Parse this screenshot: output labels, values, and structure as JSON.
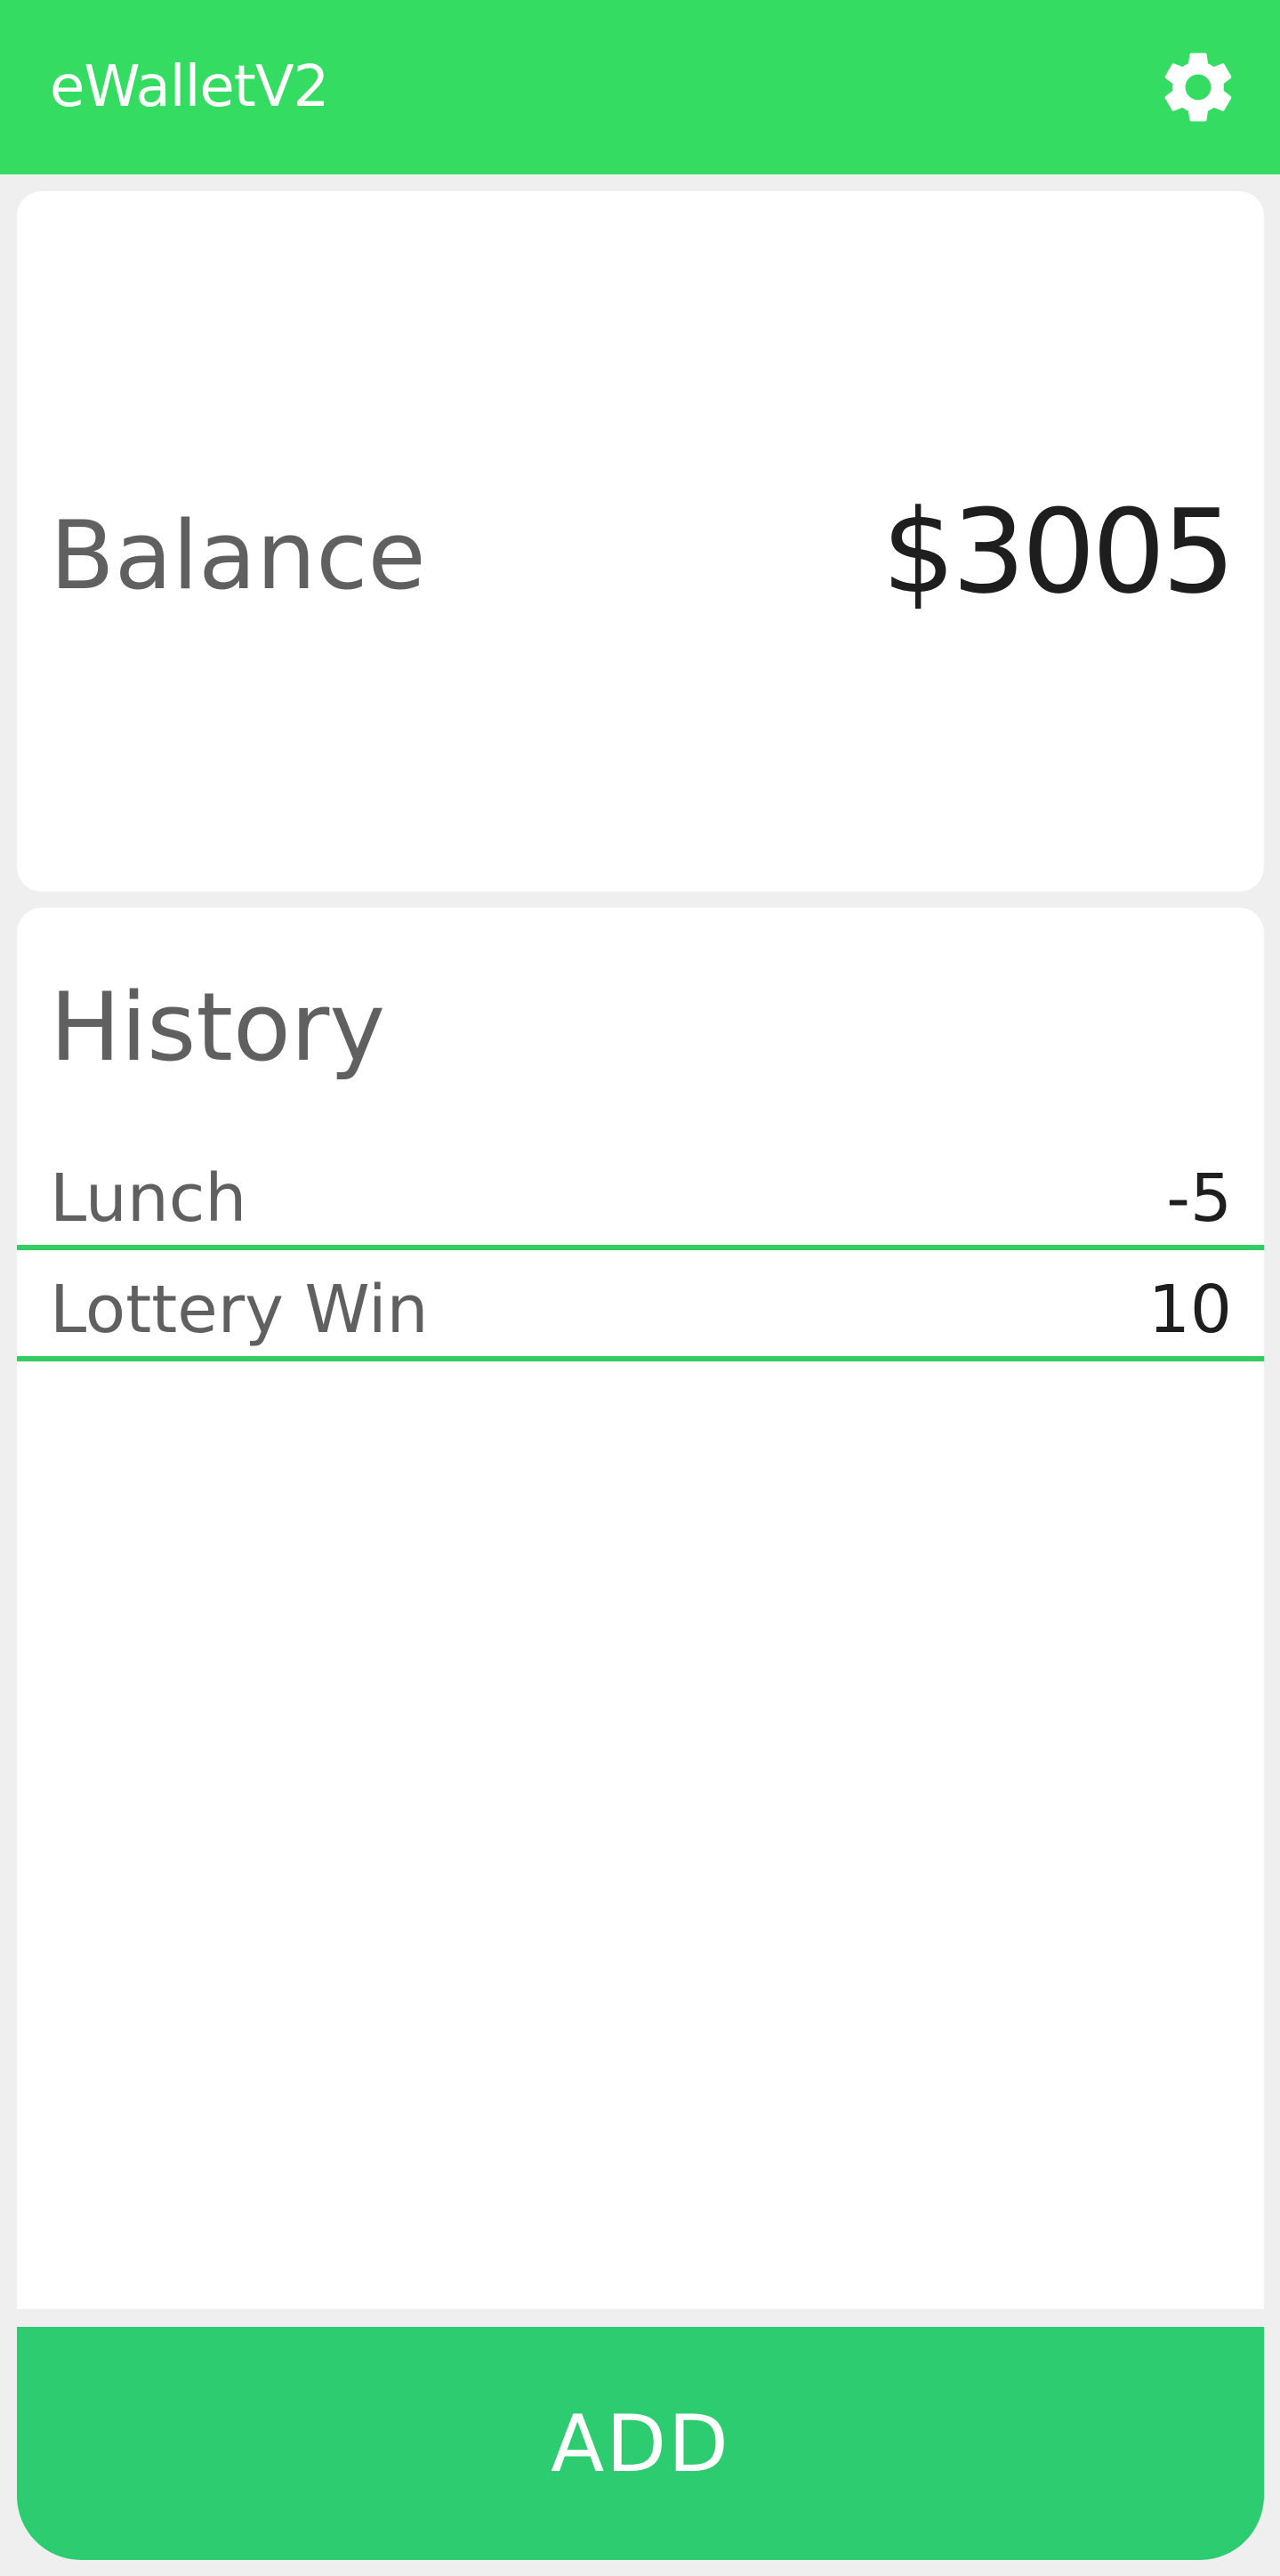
{
  "app_bar": {
    "title": "eWalletV2",
    "settings_icon": "gear-icon",
    "color": "#34dc62"
  },
  "balance": {
    "label": "Balance",
    "value": "$3005"
  },
  "history": {
    "title": "History",
    "divider_color": "#34cc63",
    "items": [
      {
        "label": "Lunch",
        "amount": "-5"
      },
      {
        "label": "Lottery Win",
        "amount": "10"
      }
    ]
  },
  "add_button": {
    "label": "ADD",
    "color": "#2ecc71"
  }
}
